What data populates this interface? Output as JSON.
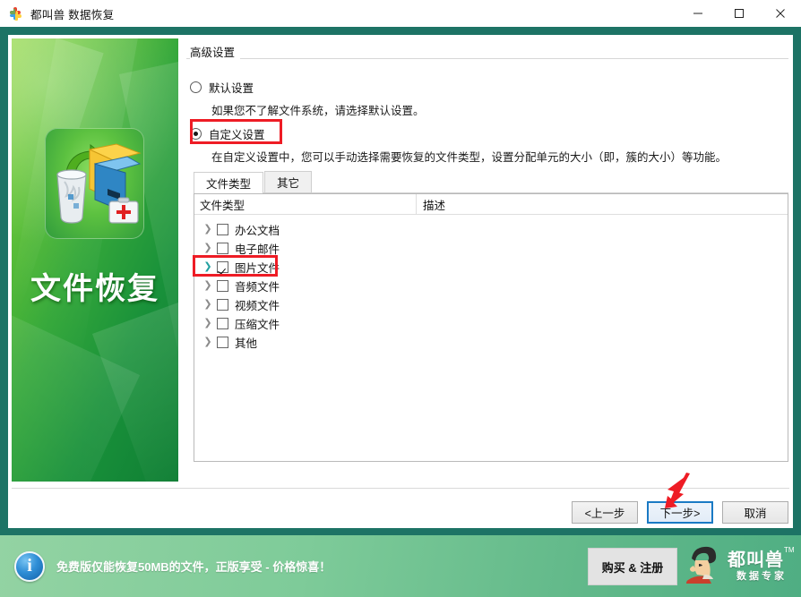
{
  "window": {
    "title": "都叫兽 数据恢复",
    "icon": "app-puzzle-icon",
    "minimize": "—",
    "maximize": "▢",
    "close": "✕",
    "border_color": "#1d7365"
  },
  "left_panel": {
    "caption": "文件恢复",
    "icon": "file-recovery-icon",
    "gradient_from": "#8ed63f",
    "gradient_to": "#0f7e34"
  },
  "settings": {
    "group_label": "高级设置",
    "options": [
      {
        "label": "默认设置",
        "selected": false,
        "hint": "如果您不了解文件系统，请选择默认设置。"
      },
      {
        "label": "自定义设置",
        "selected": true,
        "hint": "在自定义设置中，您可以手动选择需要恢复的文件类型，设置分配单元的大小（即，簇的大小）等功能。"
      }
    ],
    "highlight_color": "#ee1c25"
  },
  "tabs": [
    {
      "label": "文件类型",
      "active": true
    },
    {
      "label": "其它",
      "active": false
    }
  ],
  "file_list": {
    "columns": [
      "文件类型",
      "描述"
    ],
    "rows": [
      {
        "label": "办公文档",
        "checked": false,
        "expanded": false,
        "description": "",
        "highlighted": false
      },
      {
        "label": "电子邮件",
        "checked": false,
        "expanded": false,
        "description": "",
        "highlighted": false
      },
      {
        "label": "图片文件",
        "checked": true,
        "expanded": false,
        "description": "",
        "highlighted": true
      },
      {
        "label": "音频文件",
        "checked": false,
        "expanded": false,
        "description": "",
        "highlighted": false
      },
      {
        "label": "视频文件",
        "checked": false,
        "expanded": false,
        "description": "",
        "highlighted": false
      },
      {
        "label": "压缩文件",
        "checked": false,
        "expanded": false,
        "description": "",
        "highlighted": false
      },
      {
        "label": "其他",
        "checked": false,
        "expanded": false,
        "description": "",
        "highlighted": false
      }
    ]
  },
  "footer": {
    "back": "<上一步",
    "next": "下一步>",
    "cancel": "取消",
    "focused_button": "下一步>",
    "focus_color": "#1a7ac4",
    "arrow": "red-arrow-pointing-to-next"
  },
  "banner": {
    "info_icon": "info-icon",
    "message": "免费版仅能恢复50MB的文件，正版享受 - 价格惊喜！",
    "buy_button": "购买 & 注册",
    "logo_name": "都叫兽",
    "logo_tm": "TM",
    "logo_subtitle": "数据专家",
    "gradient_from": "#93d3a3",
    "gradient_to": "#4fae83"
  }
}
